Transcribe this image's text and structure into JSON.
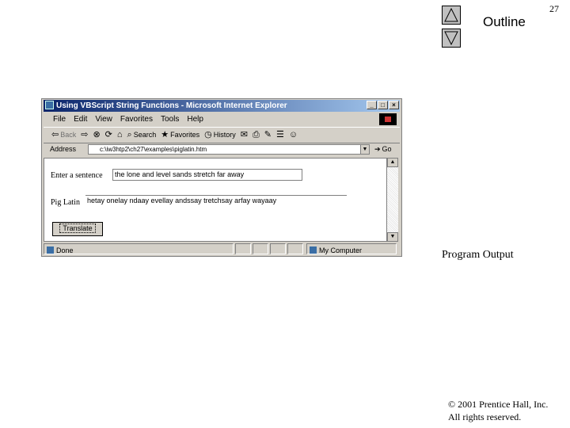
{
  "slide": {
    "number": "27",
    "outline_label": "Outline",
    "program_output_label": "Program Output",
    "copyright_line1": "© 2001 Prentice Hall, Inc.",
    "copyright_line2": "All rights reserved."
  },
  "window": {
    "title": "Using VBScript String Functions - Microsoft Internet Explorer",
    "controls": {
      "minimize": "_",
      "maximize": "□",
      "close": "×"
    }
  },
  "menu": [
    "File",
    "Edit",
    "View",
    "Favorites",
    "Tools",
    "Help"
  ],
  "toolbar": {
    "back": "Back",
    "search": "Search",
    "favorites": "Favorites",
    "history": "History"
  },
  "address": {
    "label": "Address",
    "value": "c:\\iw3htp2\\ch27\\examples\\piglatin.htm",
    "go": "Go"
  },
  "form": {
    "sentence_label": "Enter a sentence",
    "sentence_value": "the lone and level sands stretch far away",
    "piglatin_label": "Pig Latin",
    "piglatin_value": "hetay onelay ndaay evellay andssay tretchsay arfay wayaay",
    "button_label": "Translate"
  },
  "status": {
    "left_text": "Done",
    "zone_text": "My Computer"
  }
}
